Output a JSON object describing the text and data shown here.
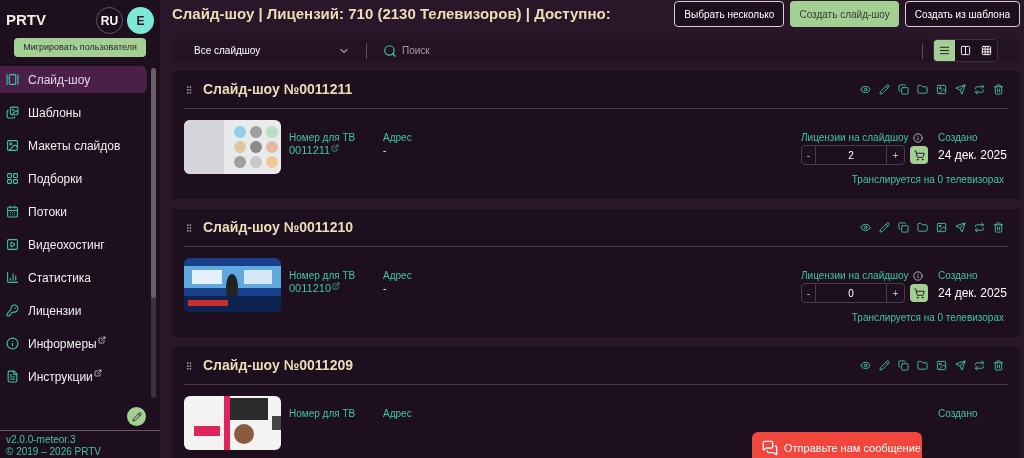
{
  "sidebar": {
    "brand": "PRTV",
    "language": "RU",
    "avatar": "E",
    "migrate_button": "Мигрировать пользователя",
    "items": [
      {
        "label": "Слайд-шоу",
        "selected": true,
        "external": false
      },
      {
        "label": "Шаблоны",
        "selected": false,
        "external": false
      },
      {
        "label": "Макеты слайдов",
        "selected": false,
        "external": false
      },
      {
        "label": "Подборки",
        "selected": false,
        "external": false
      },
      {
        "label": "Потоки",
        "selected": false,
        "external": false
      },
      {
        "label": "Видеохостинг",
        "selected": false,
        "external": false
      },
      {
        "label": "Статистика",
        "selected": false,
        "external": false
      },
      {
        "label": "Лицензии",
        "selected": false,
        "external": false
      },
      {
        "label": "Информеры",
        "selected": false,
        "external": true
      },
      {
        "label": "Инструкции",
        "selected": false,
        "external": true
      }
    ],
    "version": "v2.0.0-meteor.3",
    "copyright": "© 2019 – 2026 PRTV"
  },
  "header": {
    "title": "Слайд-шоу | Лицензий: 710 (2130 Телевизоров) | Доступно:",
    "buttons": [
      {
        "label": "Выбрать несколько",
        "kind": "outline"
      },
      {
        "label": "Создать слайд-шоу",
        "kind": "primary"
      },
      {
        "label": "Создать из шаблона",
        "kind": "outline"
      }
    ]
  },
  "filter": {
    "dropdown": "Все слайдшоу",
    "search_placeholder": "Поиск",
    "views": [
      {
        "selected": true
      },
      {
        "selected": false
      },
      {
        "selected": false
      }
    ]
  },
  "slideshows": [
    {
      "title": "Слайд-шоу №0011211",
      "tv_label": "Номер для ТВ",
      "tv_number": "0011211",
      "address_label": "Адрес",
      "address": "-",
      "licenses_label": "Лицензии на слайдшоу",
      "licenses": "2",
      "minus": "-",
      "plus": "+",
      "created_label": "Создано",
      "created": "24 дек. 2025",
      "broadcast": "Транслируется на 0 телевизорах"
    },
    {
      "title": "Слайд-шоу №0011210",
      "tv_label": "Номер для ТВ",
      "tv_number": "0011210",
      "address_label": "Адрес",
      "address": "-",
      "licenses_label": "Лицензии на слайдшоу",
      "licenses": "0",
      "minus": "-",
      "plus": "+",
      "created_label": "Создано",
      "created": "24 дек. 2025",
      "broadcast": "Транслируется на 0 телевизорах"
    },
    {
      "title": "Слайд-шоу №0011209",
      "tv_label": "Номер для ТВ",
      "address_label": "Адрес",
      "created_label": "Создано"
    }
  ],
  "chat_button": "Отправьте нам сообщение"
}
